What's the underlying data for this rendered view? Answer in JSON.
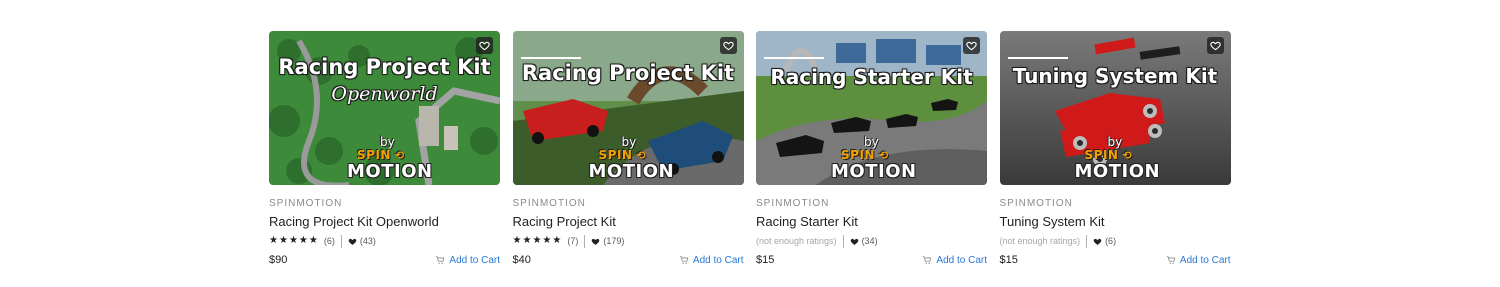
{
  "products": [
    {
      "thumb": {
        "line1": "Racing Project Kit",
        "line2": "Openworld",
        "by": "by",
        "spin": "SPIN",
        "motion": "MOTION"
      },
      "publisher": "SPINMOTION",
      "name": "Racing Project Kit Openworld",
      "rating_count": "(6)",
      "favorites": "(43)",
      "price": "$90",
      "add_to_cart": "Add to Cart"
    },
    {
      "thumb": {
        "line1": "Racing Project Kit",
        "by": "by",
        "spin": "SPIN",
        "motion": "MOTION"
      },
      "publisher": "SPINMOTION",
      "name": "Racing Project Kit",
      "rating_count": "(7)",
      "favorites": "(179)",
      "price": "$40",
      "add_to_cart": "Add to Cart"
    },
    {
      "thumb": {
        "line1": "Racing Starter Kit",
        "by": "by",
        "spin": "SPIN",
        "motion": "MOTION"
      },
      "publisher": "SPINMOTION",
      "name": "Racing Starter Kit",
      "rating_text": "(not enough ratings)",
      "favorites": "(34)",
      "price": "$15",
      "add_to_cart": "Add to Cart"
    },
    {
      "thumb": {
        "line1": "Tuning System Kit",
        "by": "by",
        "spin": "SPIN",
        "motion": "MOTION"
      },
      "publisher": "SPINMOTION",
      "name": "Tuning System Kit",
      "rating_text": "(not enough ratings)",
      "favorites": "(6)",
      "price": "$15",
      "add_to_cart": "Add to Cart"
    }
  ],
  "icons": {
    "wishlist": "heart-outline-icon",
    "favorite": "heart-filled-icon",
    "star": "star-icon",
    "cart": "cart-icon"
  },
  "colors": {
    "link": "#2878d6",
    "logo_orange": "#f5a100"
  }
}
